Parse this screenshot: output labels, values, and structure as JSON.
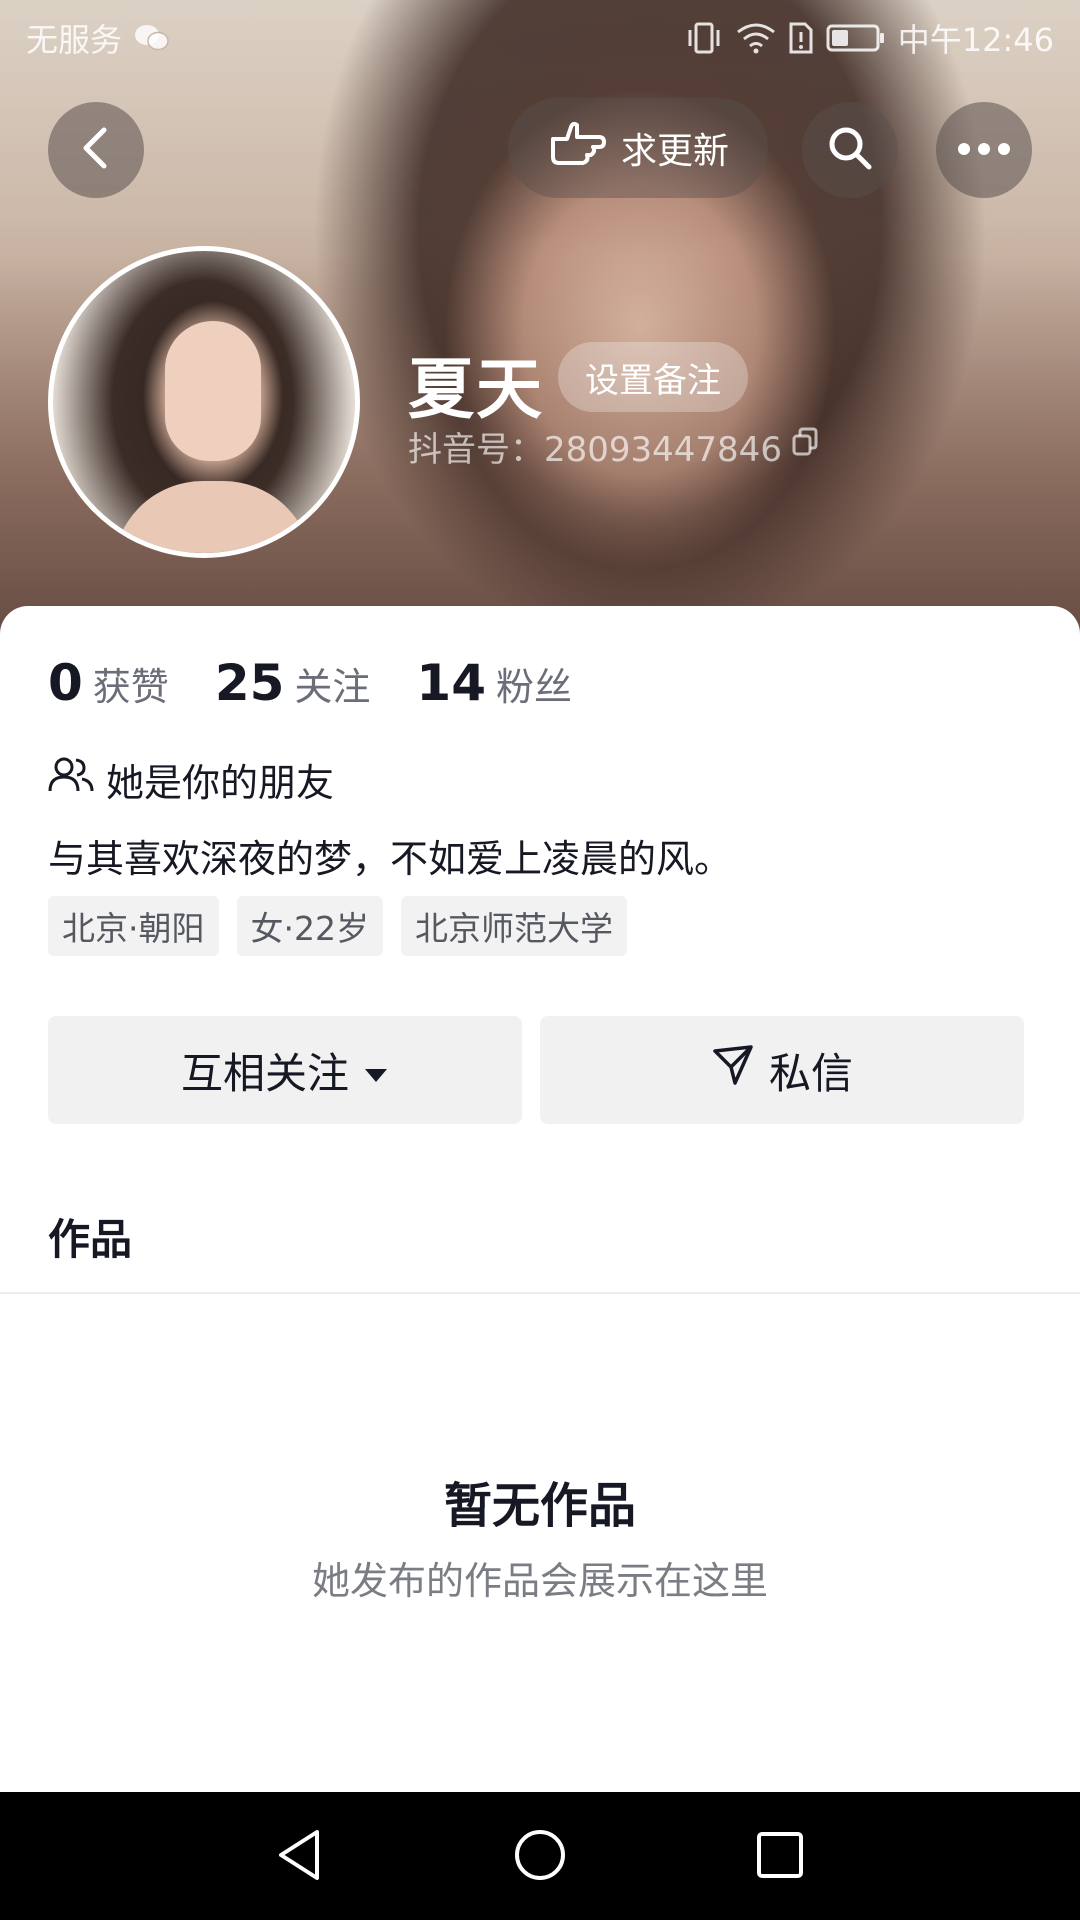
{
  "status_bar": {
    "carrier": "无服务",
    "time": "中午12:46",
    "icons": [
      "wechat-icon",
      "vibrate-icon",
      "wifi-icon",
      "sim-alert-icon",
      "battery-icon"
    ]
  },
  "top_nav": {
    "request_update_label": "求更新"
  },
  "profile": {
    "nickname": "夏天",
    "remark_label": "设置备注",
    "douyin_id": "抖音号：28093447846"
  },
  "stats": [
    {
      "value": "0",
      "label": "获赞"
    },
    {
      "value": "25",
      "label": "关注"
    },
    {
      "value": "14",
      "label": "粉丝"
    }
  ],
  "relationship": "她是你的朋友",
  "bio": "与其喜欢深夜的梦，不如爱上凌晨的风。",
  "tags": [
    "北京·朝阳",
    "女·22岁",
    "北京师范大学"
  ],
  "actions": {
    "follow_label": "互相关注",
    "message_label": "私信"
  },
  "tabs": {
    "works_label": "作品"
  },
  "empty_state": {
    "title": "暂无作品",
    "subtitle": "她发布的作品会展示在这里"
  },
  "colors": {
    "text_primary": "#161823",
    "text_secondary": "#6b6e78",
    "button_bg": "#f1f1f2"
  }
}
